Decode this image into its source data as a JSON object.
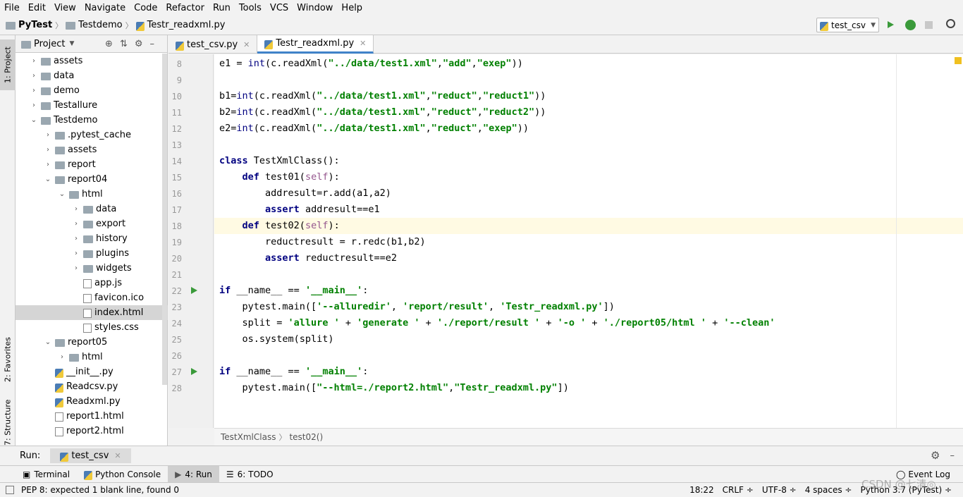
{
  "menu": [
    "File",
    "Edit",
    "View",
    "Navigate",
    "Code",
    "Refactor",
    "Run",
    "Tools",
    "VCS",
    "Window",
    "Help"
  ],
  "nav": {
    "project": "PyTest",
    "folder": "Testdemo",
    "file": "Testr_readxml.py",
    "run_config": "test_csv"
  },
  "left_tool_tabs": [
    "1: Project",
    "2: Favorites",
    "7: Structure"
  ],
  "project_panel": {
    "title": "Project",
    "tree": [
      {
        "label": "assets",
        "kind": "folder",
        "arrow": "›"
      },
      {
        "label": "data",
        "kind": "folder",
        "arrow": "›"
      },
      {
        "label": "demo",
        "kind": "folder",
        "arrow": "›"
      },
      {
        "label": "Testallure",
        "kind": "folder",
        "arrow": "›"
      },
      {
        "label": "Testdemo",
        "kind": "folder",
        "arrow": "⌄"
      },
      {
        "label": ".pytest_cache",
        "kind": "folder",
        "arrow": "›"
      },
      {
        "label": "assets",
        "kind": "folder",
        "arrow": "›"
      },
      {
        "label": "report",
        "kind": "folder",
        "arrow": "›"
      },
      {
        "label": "report04",
        "kind": "folder",
        "arrow": "⌄"
      },
      {
        "label": "html",
        "kind": "folder",
        "arrow": "⌄"
      },
      {
        "label": "data",
        "kind": "folder",
        "arrow": "›"
      },
      {
        "label": "export",
        "kind": "folder",
        "arrow": "›"
      },
      {
        "label": "history",
        "kind": "folder",
        "arrow": "›"
      },
      {
        "label": "plugins",
        "kind": "folder",
        "arrow": "›"
      },
      {
        "label": "widgets",
        "kind": "folder",
        "arrow": "›"
      },
      {
        "label": "app.js",
        "kind": "js",
        "arrow": ""
      },
      {
        "label": "favicon.ico",
        "kind": "ico",
        "arrow": ""
      },
      {
        "label": "index.html",
        "kind": "html",
        "arrow": ""
      },
      {
        "label": "styles.css",
        "kind": "css",
        "arrow": ""
      },
      {
        "label": "report05",
        "kind": "folder",
        "arrow": "⌄"
      },
      {
        "label": "html",
        "kind": "folder",
        "arrow": "›"
      },
      {
        "label": "__init__.py",
        "kind": "py",
        "arrow": ""
      },
      {
        "label": "Readcsv.py",
        "kind": "py",
        "arrow": ""
      },
      {
        "label": "Readxml.py",
        "kind": "py",
        "arrow": ""
      },
      {
        "label": "report1.html",
        "kind": "html",
        "arrow": ""
      },
      {
        "label": "report2.html",
        "kind": "html",
        "arrow": ""
      }
    ],
    "selected_index": 17
  },
  "editor_tabs": [
    {
      "label": "test_csv.py",
      "active": false
    },
    {
      "label": "Testr_readxml.py",
      "active": true
    }
  ],
  "code": {
    "lines": [
      {
        "n": "8",
        "html": "e1 = <span class=\"bi\">int</span>(c.readXml(<span class=\"str\">\"../data/test1.xml\"</span>,<span class=\"str\">\"add\"</span>,<span class=\"str\">\"exep\"</span>))"
      },
      {
        "n": "9",
        "html": ""
      },
      {
        "n": "10",
        "html": "b1=<span class=\"bi\">int</span>(c.readXml(<span class=\"str\">\"../data/test1.xml\"</span>,<span class=\"str\">\"reduct\"</span>,<span class=\"str\">\"reduct1\"</span>))"
      },
      {
        "n": "11",
        "html": "b2=<span class=\"bi\">int</span>(c.readXml(<span class=\"str\">\"../data/test1.xml\"</span>,<span class=\"str\">\"reduct\"</span>,<span class=\"str\">\"reduct2\"</span>))"
      },
      {
        "n": "12",
        "html": "e2=<span class=\"bi\">int</span>(c.readXml(<span class=\"str\">\"../data/test1.xml\"</span>,<span class=\"str\">\"reduct\"</span>,<span class=\"str\">\"exep\"</span>))"
      },
      {
        "n": "13",
        "html": ""
      },
      {
        "n": "14",
        "html": "<span class=\"kw\">class</span> TestXmlClass():"
      },
      {
        "n": "15",
        "html": "    <span class=\"kw\">def</span> test01(<span class=\"self\">self</span>):"
      },
      {
        "n": "16",
        "html": "        addresult=r.add(a1,a2)"
      },
      {
        "n": "17",
        "html": "        <span class=\"kw\">assert</span> addresult==e1"
      },
      {
        "n": "18",
        "html": "    <span class=\"kw\">def</span> test02(<span class=\"self\">self</span>):"
      },
      {
        "n": "19",
        "html": "        reductresult = r.redc(b1,b2)"
      },
      {
        "n": "20",
        "html": "        <span class=\"kw\">assert</span> reductresult==e2"
      },
      {
        "n": "21",
        "html": ""
      },
      {
        "n": "22",
        "html": "<span class=\"kw\">if</span> __name__ == <span class=\"str\">'__main__'</span>:"
      },
      {
        "n": "23",
        "html": "    pytest.main([<span class=\"str\">'--alluredir'</span>, <span class=\"str\">'report/result'</span>, <span class=\"str\">'Testr_readxml.py'</span>])"
      },
      {
        "n": "24",
        "html": "    split = <span class=\"str\">'allure '</span> + <span class=\"str\">'generate '</span> + <span class=\"str\">'./report/result '</span> + <span class=\"str\">'-o '</span> + <span class=\"str\">'./report05/html '</span> + <span class=\"str\">'--clean'</span>"
      },
      {
        "n": "25",
        "html": "    os.system(split)"
      },
      {
        "n": "26",
        "html": ""
      },
      {
        "n": "27",
        "html": "<span class=\"kw\">if</span> __name__ == <span class=\"str\">'__main__'</span>:"
      },
      {
        "n": "28",
        "html": "    pytest.main([<span class=\"str\">\"--html=./report2.html\"</span>,<span class=\"str\">\"Testr_readxml.py\"</span>])"
      }
    ]
  },
  "editor_breadcrumb": {
    "cls": "TestXmlClass",
    "method": "test02()"
  },
  "run": {
    "label": "Run:",
    "tab": "test_csv"
  },
  "bottom_tabs": [
    "Terminal",
    "Python Console",
    "4: Run",
    "6: TODO"
  ],
  "event_log": "Event Log",
  "status": {
    "message": "PEP 8: expected 1 blank line, found 0",
    "position": "18:22",
    "line_sep": "CRLF ÷",
    "encoding": "UTF-8 ÷",
    "indent": "4 spaces ÷",
    "interpreter": "Python 3.7 (PyTest) ÷",
    "watermark": "CSDN @七清◎"
  }
}
